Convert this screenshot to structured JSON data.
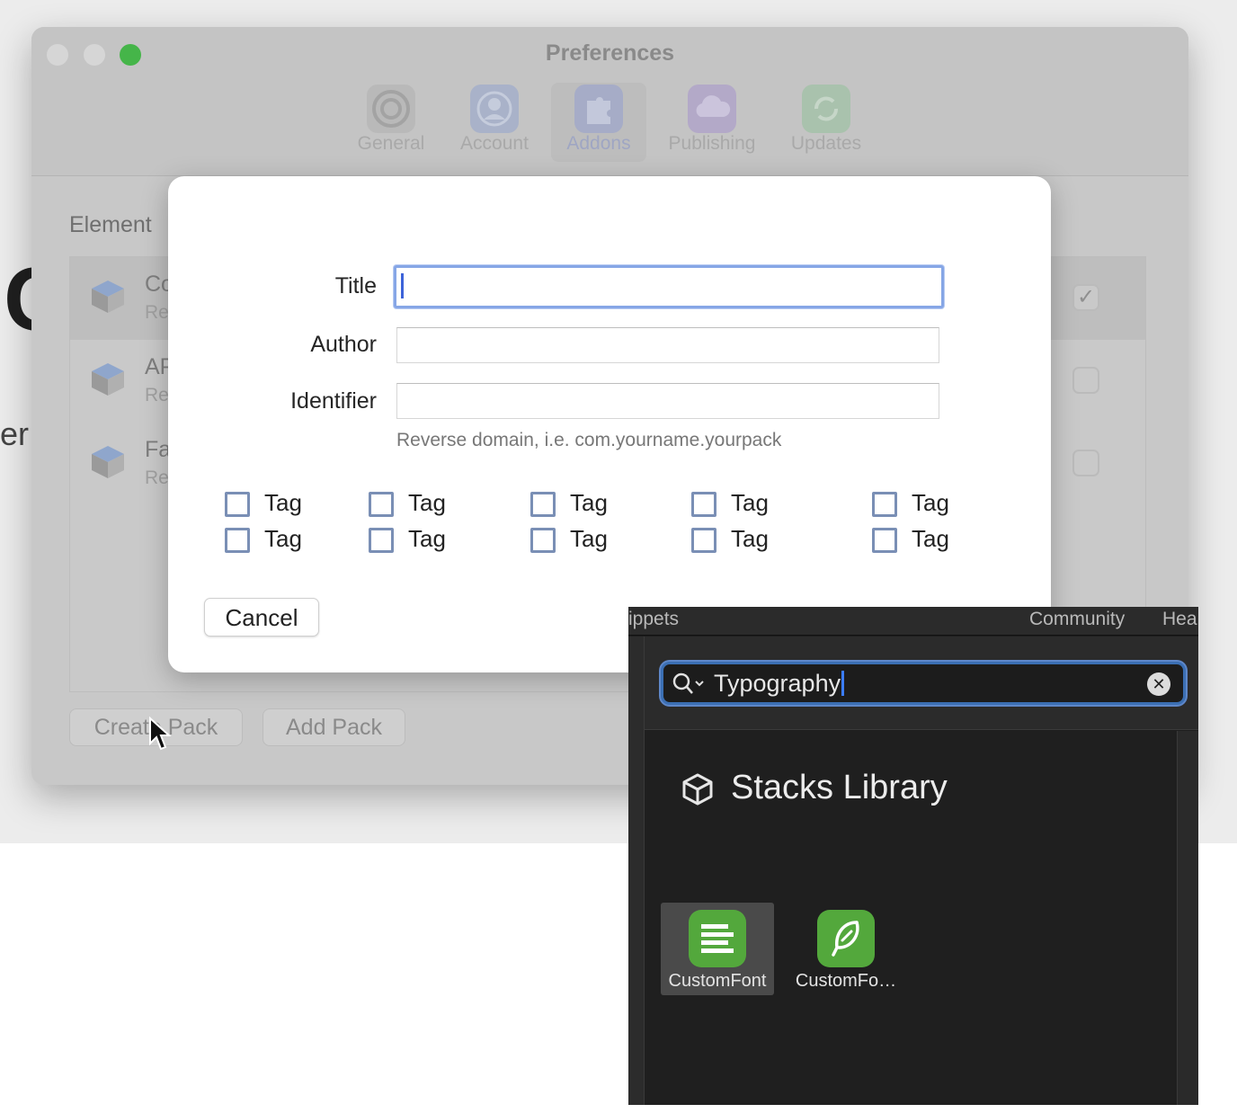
{
  "preferences_window": {
    "title": "Preferences",
    "toolbar_tabs": [
      {
        "label": "General",
        "icon": "gear-icon"
      },
      {
        "label": "Account",
        "icon": "person-icon"
      },
      {
        "label": "Addons",
        "icon": "puzzle-icon",
        "active": true
      },
      {
        "label": "Publishing",
        "icon": "cloud-icon"
      },
      {
        "label": "Updates",
        "icon": "refresh-icon"
      }
    ],
    "section_heading": "Element",
    "packs": [
      {
        "name": "Co",
        "subtitle": "Re",
        "checked": true
      },
      {
        "name": "AP",
        "subtitle": "Re",
        "checked": false
      },
      {
        "name": "Fa",
        "subtitle": "Re",
        "checked": false
      }
    ],
    "buttons": {
      "create_pack": "Create Pack",
      "add_pack": "Add Pack"
    }
  },
  "background": {
    "big_glyph": "C",
    "side_text": "er"
  },
  "dialog": {
    "title_label": "Title",
    "title_value": "",
    "author_label": "Author",
    "author_value": "",
    "identifier_label": "Identifier",
    "identifier_value": "",
    "identifier_hint": "Reverse domain, i.e. com.yourname.yourpack",
    "tags": [
      "Tag",
      "Tag",
      "Tag",
      "Tag",
      "Tag",
      "Tag",
      "Tag",
      "Tag",
      "Tag",
      "Tag"
    ],
    "cancel_label": "Cancel"
  },
  "stacks_panel": {
    "tabs": {
      "snippets": "ippets",
      "community": "Community",
      "help": "Hea"
    },
    "search_value": "Typography",
    "library_title": "Stacks Library",
    "items": [
      {
        "label": "CustomFont",
        "icon": "text-lines-icon",
        "selected": true
      },
      {
        "label": "CustomFo…",
        "icon": "feather-icon",
        "selected": false
      }
    ],
    "colors": {
      "accent": "#3b6fb3",
      "stack_green": "#53a83c",
      "traffic_green": "#45b549"
    }
  }
}
